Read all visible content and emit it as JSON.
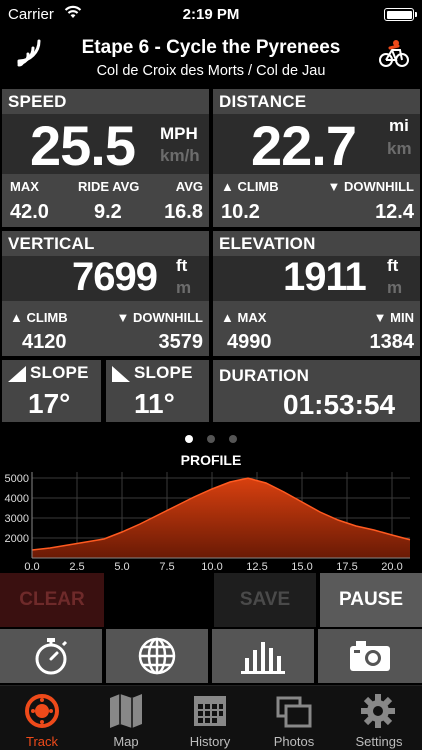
{
  "status_bar": {
    "carrier": "Carrier",
    "time": "2:19 PM"
  },
  "header": {
    "title": "Etape 6 - Cycle the Pyrenees",
    "subtitle": "Col de Croix des Morts / Col de Jau"
  },
  "speed": {
    "label": "SPEED",
    "value": "25.5",
    "unit_active": "MPH",
    "unit_inactive": "km/h",
    "max_label": "MAX",
    "max": "42.0",
    "ride_avg_label": "RIDE AVG",
    "ride_avg": "9.2",
    "avg_label": "AVG",
    "avg": "16.8"
  },
  "distance": {
    "label": "DISTANCE",
    "value": "22.7",
    "unit_active": "mi",
    "unit_inactive": "km",
    "climb_label": "CLIMB",
    "climb": "10.2",
    "downhill_label": "DOWNHILL",
    "downhill": "12.4"
  },
  "vertical": {
    "label": "VERTICAL",
    "value": "7699",
    "unit_active": "ft",
    "unit_inactive": "m",
    "climb_label": "CLIMB",
    "climb": "4120",
    "downhill_label": "DOWNHILL",
    "downhill": "3579"
  },
  "elevation": {
    "label": "ELEVATION",
    "value": "1911",
    "unit_active": "ft",
    "unit_inactive": "m",
    "max_label": "MAX",
    "max": "4990",
    "min_label": "MIN",
    "min": "1384"
  },
  "slope_up": {
    "label": "SLOPE",
    "value": "17°"
  },
  "slope_down": {
    "label": "SLOPE",
    "value": "11°"
  },
  "duration": {
    "label": "DURATION",
    "value": "01:53:54"
  },
  "pager": {
    "count": 3,
    "active": 0
  },
  "colors": {
    "accent": "#ee4a1a",
    "tile": "#454545",
    "band": "#2c2c2c",
    "profile_fill": "#d8400f"
  },
  "controls": {
    "clear": "CLEAR",
    "save": "SAVE",
    "pause": "PAUSE"
  },
  "toolbar_icons": [
    "stopwatch-icon",
    "globe-icon",
    "bar-chart-icon",
    "camera-icon"
  ],
  "tabs": [
    {
      "label": "Track",
      "icon": "track-icon",
      "active": true
    },
    {
      "label": "Map",
      "icon": "map-icon",
      "active": false
    },
    {
      "label": "History",
      "icon": "history-icon",
      "active": false
    },
    {
      "label": "Photos",
      "icon": "photos-icon",
      "active": false
    },
    {
      "label": "Settings",
      "icon": "settings-icon",
      "active": false
    }
  ],
  "chart_data": {
    "type": "area",
    "title": "PROFILE",
    "xlabel": "",
    "ylabel": "",
    "xlim": [
      0,
      21
    ],
    "ylim": [
      1000,
      5300
    ],
    "xticks": [
      "0.0",
      "2.5",
      "5.0",
      "7.5",
      "10.0",
      "12.5",
      "15.0",
      "17.5",
      "20.0"
    ],
    "yticks": [
      "2000",
      "3000",
      "4000",
      "5000"
    ],
    "grid": true,
    "x": [
      0,
      1,
      2,
      3,
      4,
      5,
      6,
      7,
      8,
      9,
      10,
      11,
      12,
      13,
      14,
      15,
      16,
      17,
      18,
      19,
      20,
      21
    ],
    "series": [
      {
        "values": [
          1400,
          1500,
          1650,
          1800,
          1950,
          2300,
          2700,
          3150,
          3600,
          4050,
          4450,
          4800,
          4990,
          4750,
          4300,
          3800,
          3300,
          2900,
          2600,
          2400,
          2150,
          1911
        ]
      }
    ]
  }
}
